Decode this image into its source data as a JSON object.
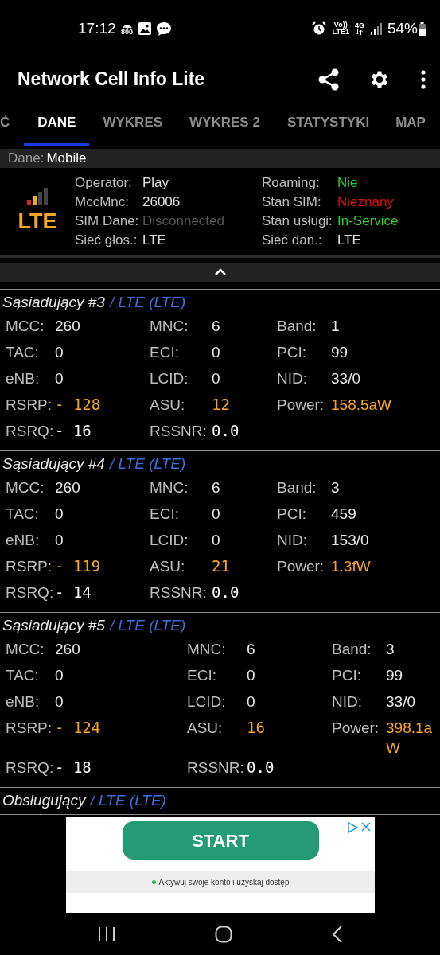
{
  "status_bar": {
    "time": "17:12",
    "hotspot": "800",
    "volte": [
      "Vo))",
      "LTE1"
    ],
    "network": "4G",
    "battery": "54%"
  },
  "app_bar": {
    "title": "Network Cell Info Lite"
  },
  "tabs": [
    {
      "label": "Ć",
      "selected": false
    },
    {
      "label": "DANE",
      "selected": true
    },
    {
      "label": "WYKRES",
      "selected": false
    },
    {
      "label": "WYKRES 2",
      "selected": false
    },
    {
      "label": "STATYSTYKI",
      "selected": false
    },
    {
      "label": "MAP",
      "selected": false
    }
  ],
  "data_bar": {
    "label": "Dane:",
    "value": "Mobile"
  },
  "summary": {
    "technology": "LTE",
    "left": [
      {
        "label": "Operator:",
        "value": "Play",
        "color": "#e0e0e0"
      },
      {
        "label": "MccMnc:",
        "value": "26006",
        "color": "#e0e0e0"
      },
      {
        "label": "SIM Dane:",
        "value": "Disconnected",
        "color": "#555555"
      },
      {
        "label": "Sieć głos.:",
        "value": "LTE",
        "color": "#e0e0e0"
      }
    ],
    "right": [
      {
        "label": "Roaming:",
        "value": "Nie",
        "color": "#33cc33"
      },
      {
        "label": "Stan SIM:",
        "value": "Nieznany",
        "color": "#dd1111"
      },
      {
        "label": "Stan usługi:",
        "value": "In-Service",
        "color": "#33cc33"
      },
      {
        "label": "Sieć dan.:",
        "value": "LTE",
        "color": "#e0e0e0"
      }
    ]
  },
  "sections": [
    {
      "title": "Sąsiadujący #3",
      "subtitle": "/ LTE (LTE)",
      "kind": "compact",
      "rows": [
        [
          {
            "label": "MCC:",
            "value": "260",
            "kind": "plain"
          },
          {
            "label": "MNC:",
            "value": "6",
            "kind": "plain"
          },
          {
            "label": "Band:",
            "value": "1",
            "kind": "plain"
          }
        ],
        [
          {
            "label": "TAC:",
            "value": "0",
            "kind": "plain"
          },
          {
            "label": "ECI:",
            "value": "0",
            "kind": "plain"
          },
          {
            "label": "PCI:",
            "value": "99",
            "kind": "plain"
          }
        ],
        [
          {
            "label": "eNB:",
            "value": "0",
            "kind": "plain"
          },
          {
            "label": "LCID:",
            "value": "0",
            "kind": "plain"
          },
          {
            "label": "NID:",
            "value": "33/0",
            "kind": "plain"
          }
        ],
        [
          {
            "label": "RSRP:",
            "value": "- 128",
            "kind": "meter"
          },
          {
            "label": "ASU:",
            "value": "12",
            "kind": "meter"
          },
          {
            "label": "Power:",
            "value": "158.5aW",
            "kind": "accent"
          }
        ],
        [
          {
            "label": "RSRQ:",
            "value": "- 16",
            "kind": "lcd"
          },
          {
            "label": "RSSNR:",
            "value": "0.0",
            "kind": "lcd"
          }
        ]
      ]
    },
    {
      "title": "Sąsiadujący #4",
      "subtitle": "/ LTE (LTE)",
      "kind": "compact",
      "rows": [
        [
          {
            "label": "MCC:",
            "value": "260",
            "kind": "plain"
          },
          {
            "label": "MNC:",
            "value": "6",
            "kind": "plain"
          },
          {
            "label": "Band:",
            "value": "3",
            "kind": "plain"
          }
        ],
        [
          {
            "label": "TAC:",
            "value": "0",
            "kind": "plain"
          },
          {
            "label": "ECI:",
            "value": "0",
            "kind": "plain"
          },
          {
            "label": "PCI:",
            "value": "459",
            "kind": "plain"
          }
        ],
        [
          {
            "label": "eNB:",
            "value": "0",
            "kind": "plain"
          },
          {
            "label": "LCID:",
            "value": "0",
            "kind": "plain"
          },
          {
            "label": "NID:",
            "value": "153/0",
            "kind": "plain"
          }
        ],
        [
          {
            "label": "RSRP:",
            "value": "- 119",
            "kind": "meter"
          },
          {
            "label": "ASU:",
            "value": "21",
            "kind": "meter"
          },
          {
            "label": "Power:",
            "value": "1.3fW",
            "kind": "accent"
          }
        ],
        [
          {
            "label": "RSRQ:",
            "value": "- 14",
            "kind": "lcd"
          },
          {
            "label": "RSSNR:",
            "value": "0.0",
            "kind": "lcd"
          }
        ]
      ]
    },
    {
      "title": "Sąsiadujący #5",
      "subtitle": "/ LTE (LTE)",
      "kind": "wide",
      "rows": [
        [
          {
            "label": "MCC:",
            "value": "260",
            "kind": "plain"
          },
          {
            "label": "MNC:",
            "value": "6",
            "kind": "plain"
          },
          {
            "label": "Band:",
            "value": "3",
            "kind": "plain"
          }
        ],
        [
          {
            "label": "TAC:",
            "value": "0",
            "kind": "plain"
          },
          {
            "label": "ECI:",
            "value": "0",
            "kind": "plain"
          },
          {
            "label": "PCI:",
            "value": "99",
            "kind": "plain"
          }
        ],
        [
          {
            "label": "eNB:",
            "value": "0",
            "kind": "plain"
          },
          {
            "label": "LCID:",
            "value": "0",
            "kind": "plain"
          },
          {
            "label": "NID:",
            "value": "33/0",
            "kind": "plain"
          }
        ],
        [
          {
            "label": "RSRP:",
            "value": "- 124",
            "kind": "meter"
          },
          {
            "label": "ASU:",
            "value": "16",
            "kind": "meter"
          },
          {
            "label": "Power:",
            "value": "398.1aW",
            "kind": "accent"
          }
        ],
        [
          {
            "label": "RSRQ:",
            "value": "- 18",
            "kind": "lcd"
          },
          {
            "label": "RSSNR:",
            "value": "0.0",
            "kind": "lcd"
          }
        ]
      ]
    },
    {
      "title": "Obsługujący",
      "subtitle": "/ LTE (LTE)",
      "kind": "header"
    }
  ],
  "ad": {
    "button": "START",
    "note": "Aktywuj swoje konto i uzyskaj dostęp"
  }
}
